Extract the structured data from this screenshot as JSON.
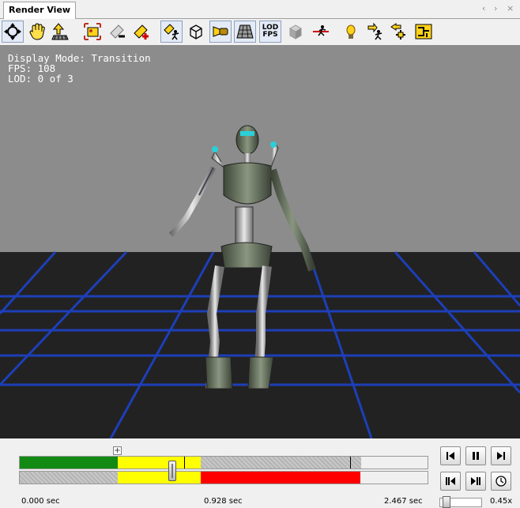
{
  "tab": {
    "title": "Render View"
  },
  "tab_controls": {
    "back": "‹",
    "forward": "›",
    "close": "×"
  },
  "toolbar": {
    "lod_fps_label_top": "LOD",
    "lod_fps_label_bottom": "FPS",
    "buttons": [
      "orbit-icon",
      "pan-hand-icon",
      "zoom-icon",
      "frame-selection-icon",
      "light-remove-icon",
      "light-add-icon",
      "animation-mode-icon",
      "wireframe-cube-icon",
      "spotlight-icon",
      "floor-grid-icon",
      "lod-fps-icon",
      "shaded-cube-icon",
      "bone-link-icon",
      "light-bulb-icon",
      "running-figure-icon",
      "arrow-back-icon",
      "arrow-cross-icon",
      "skeleton-layout-icon"
    ]
  },
  "hud": {
    "display_mode": "Display Mode: Transition",
    "fps": "FPS: 108",
    "lod": "LOD: 0 of 3"
  },
  "timeline": {
    "start_label": "0.000 sec",
    "current_label": "0.928 sec",
    "end_label": "2.467 sec",
    "plus": "+",
    "colors": {
      "green": "#138a13",
      "yellow": "#ffff00",
      "red": "#ff0000",
      "hatch": "#bdbdbd"
    }
  },
  "playback": {
    "buttons": [
      "jump-to-start-icon",
      "pause-icon",
      "jump-to-end-icon",
      "step-back-icon",
      "step-forward-icon",
      "clock-icon"
    ]
  },
  "speed": {
    "label": "0.45x",
    "value": 0.45
  }
}
